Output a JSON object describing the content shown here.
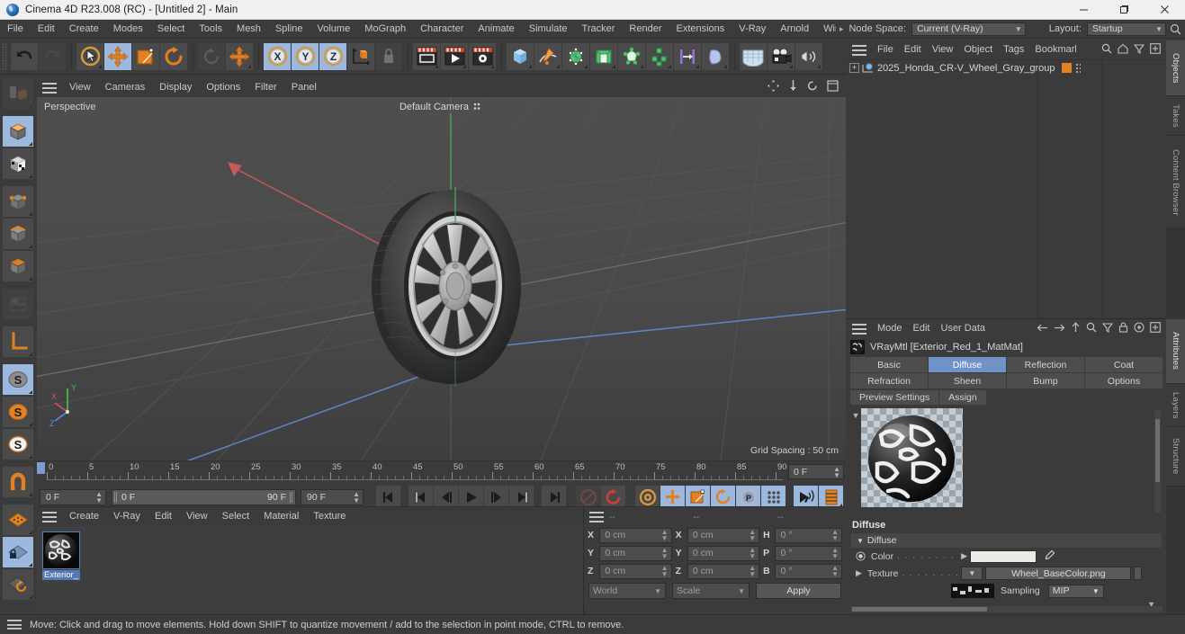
{
  "window": {
    "title": "Cinema 4D R23.008 (RC) - [Untitled 2] - Main",
    "minimize": "–",
    "maximize": "❐",
    "close": "✕"
  },
  "menubar": {
    "items": [
      "File",
      "Edit",
      "Create",
      "Modes",
      "Select",
      "Tools",
      "Mesh",
      "Spline",
      "Volume",
      "MoGraph",
      "Character",
      "Animate",
      "Simulate",
      "Tracker",
      "Render",
      "Extensions",
      "V-Ray",
      "Arnold",
      "Wind"
    ],
    "overflow_arrow": "▸",
    "node_space_label": "Node Space:",
    "node_space_value": "Current (V-Ray)",
    "layout_label": "Layout:",
    "layout_value": "Startup"
  },
  "toolbar": {
    "undo": "undo",
    "redo": "redo",
    "tools": [
      "Live Selection",
      "Move",
      "Scale",
      "Rotate",
      "Dynamic Place",
      "World Axis"
    ],
    "axes": [
      "X",
      "Y",
      "Z"
    ],
    "object_axis": "Object Axis",
    "locked": "Lock Axis",
    "render_view": "Render View",
    "render_picture": "Render to Picture Viewer",
    "render_settings": "Render Settings",
    "primitive": "Cube",
    "spline": "Pen",
    "generator": "Subdivision Surface",
    "scene": "Scene",
    "deformer": "Deformer",
    "array": "Array",
    "mograph": "MoGraph",
    "field": "Field",
    "environment": "Environment",
    "camera": "Camera",
    "light": "Light"
  },
  "left_tools": [
    {
      "name": "make-editable",
      "state": "dim"
    },
    {
      "name": "model-mode",
      "state": "on"
    },
    {
      "name": "texture-mode",
      "state": "off"
    },
    {
      "name": "points-mode",
      "state": "off"
    },
    {
      "name": "edges-mode",
      "state": "off"
    },
    {
      "name": "polygons-mode",
      "state": "off"
    },
    {
      "name": "uv-mode",
      "state": "dim"
    },
    {
      "name": "workplane",
      "state": "off"
    },
    {
      "name": "enable-axis",
      "state": "on"
    },
    {
      "name": "enable-snap",
      "state": "off"
    },
    {
      "name": "quantize",
      "state": "off"
    },
    {
      "name": "magnet",
      "state": "off"
    },
    {
      "name": "workplane-grid",
      "state": "off"
    },
    {
      "name": "lock-workplane",
      "state": "on"
    },
    {
      "name": "planar-workplane",
      "state": "off"
    }
  ],
  "viewport": {
    "menu": [
      "View",
      "Cameras",
      "Display",
      "Options",
      "Filter",
      "Panel"
    ],
    "label": "Perspective",
    "camera": "Default Camera",
    "grid_spacing": "Grid Spacing : 50 cm",
    "axis_labels": {
      "x": "X",
      "y": "Y",
      "z": "Z"
    }
  },
  "timeline": {
    "ticks": [
      "0",
      "5",
      "10",
      "15",
      "20",
      "25",
      "30",
      "35",
      "40",
      "45",
      "50",
      "55",
      "60",
      "65",
      "70",
      "75",
      "80",
      "85",
      "90"
    ],
    "current_frame_field": "0 F",
    "start_field": "0 F",
    "range_start": "0 F",
    "range_end": "90 F",
    "end_field": "90 F",
    "transport": [
      "go-to-start",
      "step-back-keyframe",
      "step-back-frame",
      "play",
      "step-forward-frame",
      "step-forward-keyframe",
      "go-to-end"
    ],
    "record_active": "Record Active Objects",
    "autokey": "Autokeying",
    "key_tools": [
      "Keyframe Selection",
      "Position",
      "Scale",
      "Rotation",
      "Parameter",
      "Point Level Animation"
    ],
    "extra": [
      "Play Sound",
      "Filter Timeline"
    ]
  },
  "material_manager": {
    "menu": [
      "Create",
      "V-Ray",
      "Edit",
      "View",
      "Select",
      "Material",
      "Texture"
    ],
    "materials": [
      {
        "name": "Exterior_"
      }
    ]
  },
  "coordinates": {
    "header": [
      "--",
      "--",
      "--"
    ],
    "rows": [
      {
        "pos_label": "X",
        "pos": "0 cm",
        "size_label": "X",
        "size": "0 cm",
        "rot_label": "H",
        "rot": "0 °"
      },
      {
        "pos_label": "Y",
        "pos": "0 cm",
        "size_label": "Y",
        "size": "0 cm",
        "rot_label": "P",
        "rot": "0 °"
      },
      {
        "pos_label": "Z",
        "pos": "0 cm",
        "size_label": "Z",
        "size": "0 cm",
        "rot_label": "B",
        "rot": "0 °"
      }
    ],
    "system": "World",
    "mode": "Scale",
    "apply": "Apply"
  },
  "object_manager": {
    "menu": [
      "File",
      "Edit",
      "View",
      "Object",
      "Tags",
      "Bookmarks"
    ],
    "objects": [
      {
        "name": "2025_Honda_CR-V_Wheel_Gray_group"
      }
    ]
  },
  "attribute_manager": {
    "menu": [
      "Mode",
      "Edit",
      "User Data"
    ],
    "title": "VRayMtl [Exterior_Red_1_MatMat]",
    "tabs_row1": [
      "Basic",
      "Diffuse",
      "Reflection",
      "Coat"
    ],
    "tabs_row2": [
      "Refraction",
      "Sheen",
      "Bump",
      "Options"
    ],
    "active_tab": "Diffuse",
    "sub_buttons": [
      "Preview Settings",
      "Assign"
    ],
    "section_title": "Diffuse",
    "group_header": "Diffuse",
    "rows": {
      "color_label": "Color",
      "color_dots": ". . . . . . . . . .",
      "color_value": "#EDECE8",
      "texture_label": "Texture",
      "texture_dots": ". . . . . . . . . .",
      "texture_value": "Wheel_BaseColor.png",
      "sampling_label": "Sampling",
      "sampling_value": "MIP"
    }
  },
  "vertical_tabs": [
    {
      "label": "Objects",
      "selected": true
    },
    {
      "label": "Takes",
      "selected": false
    },
    {
      "label": "Content Browser",
      "selected": false
    },
    {
      "label": "Attributes",
      "selected": true
    },
    {
      "label": "Layers",
      "selected": false
    },
    {
      "label": "Structure",
      "selected": false
    }
  ],
  "statusbar": {
    "text": "Move: Click and drag to move elements. Hold down SHIFT to quantize movement / add to the selection in point mode, CTRL to remove."
  },
  "colors": {
    "accent_blue": "#6f93c9",
    "orange": "#e08124",
    "panel_bg": "#3b3b3b",
    "viewport_bg": "#4a4a4a"
  }
}
